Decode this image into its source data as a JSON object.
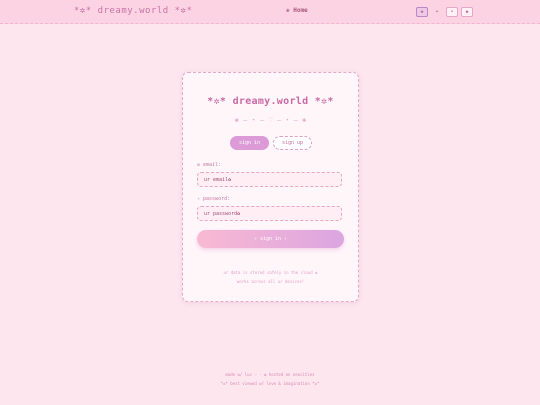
{
  "header": {
    "brand": "*✲* dreamy.world *✲*",
    "home_label": "❀ Home",
    "controls": [
      "◆",
      "+",
      "•",
      "◆"
    ]
  },
  "card": {
    "title": "*✲* dreamy.world *✲*",
    "divider": "❀  — ⋆ —  ♡  — ⋆ —  ❀",
    "tabs": [
      {
        "label": "sign in",
        "active": true
      },
      {
        "label": "sign up",
        "active": false
      }
    ],
    "email": {
      "label": "✉ email:",
      "placeholder": "ur email✿"
    },
    "password": {
      "label": "✧ password:",
      "placeholder": "ur password✿"
    },
    "submit_label": "✧ sign in ✧",
    "note_line1": "ur data is stored safely in the cloud ❀",
    "note_line2": "works across all ur devices!"
  },
  "footer": {
    "line1": "made w/ luv ♡ · ❀ hosted on neocities",
    "line2": "*✲* best viewed w/ love & imagination *✲*"
  },
  "colors": {
    "background": "#fde6ee",
    "accent": "#dc9ad6",
    "text": "#c46f9c"
  }
}
